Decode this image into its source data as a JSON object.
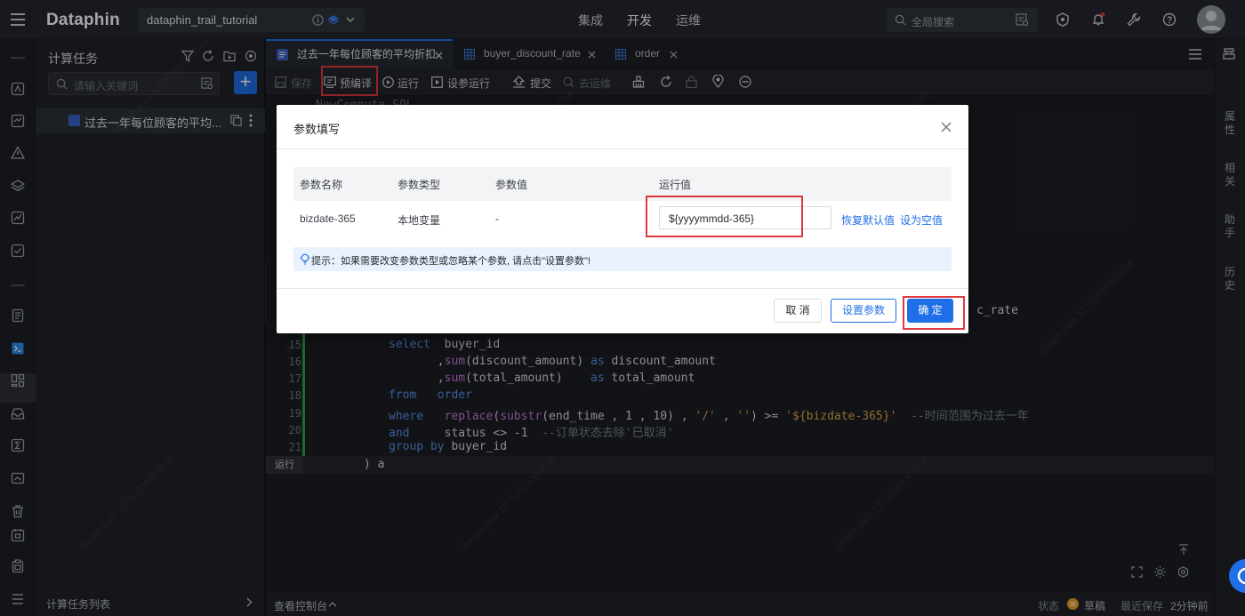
{
  "header": {
    "logo": "Dataphin",
    "project": "dataphin_trail_tutorial",
    "nav": [
      "集成",
      "开发",
      "运维"
    ],
    "search_placeholder": "全局搜索"
  },
  "sidebar": {
    "title": "计算任务",
    "search_placeholder": "请输入关键词",
    "add_label": "+",
    "task_label": "过去一年每位顾客的平均...",
    "footer": "计算任务列表"
  },
  "tabs": [
    "过去一年每位顾客的平均折扣",
    "buyer_discount_rate",
    "order"
  ],
  "toolbar": {
    "save": "保存",
    "precompile": "预编译",
    "run": "运行",
    "param_run": "设参运行",
    "submit": "提交",
    "deploy": "去运维"
  },
  "editor": {
    "line_numbers": [
      "15",
      "16",
      "17",
      "18",
      "19",
      "20",
      "21"
    ],
    "partial_top": "NewCompute SQL",
    "partial_right": "c_rate",
    "run_label": "运行",
    "closing": ") a"
  },
  "right_panel": [
    "属性",
    "相关",
    "助手",
    "历史"
  ],
  "status_bar": {
    "console": "查看控制台",
    "state_label": "状态",
    "state_value": "草稿",
    "last_save_label": "最近保存",
    "last_save_value": "2分钟前"
  },
  "modal": {
    "title": "参数填写",
    "columns": [
      "参数名称",
      "参数类型",
      "参数值",
      "运行值"
    ],
    "row": {
      "name": "bizdate-365",
      "type": "本地变量",
      "value": "-",
      "run_value": "${yyyymmdd-365}"
    },
    "restore_default": "恢复默认值",
    "set_empty": "设为空值",
    "tip": "提示：如果需要改变参数类型或忽略某个参数, 请点击\"设置参数\"!",
    "cancel": "取 消",
    "set_params": "设置参数",
    "confirm": "确 定"
  },
  "colors": {
    "accent": "#1f6fe8",
    "highlight": "#e0383e",
    "background": "#15171c"
  }
}
